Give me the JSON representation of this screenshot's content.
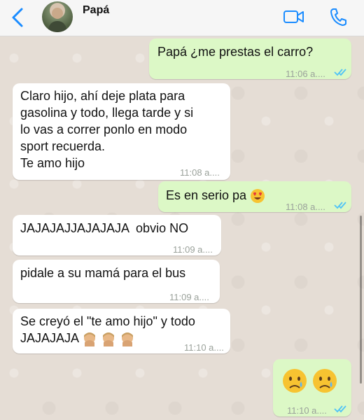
{
  "header": {
    "contact_name": "Papá"
  },
  "messages": [
    {
      "id": "m1",
      "direction": "outgoing",
      "text": "Papá ¿me prestas el carro?",
      "time": "11:06 a....",
      "read": true
    },
    {
      "id": "m2",
      "direction": "incoming",
      "lines": [
        "Claro hijo, ahí deje plata para",
        "gasolina y todo, llega tarde y si",
        "lo vas a correr ponlo en modo",
        "sport recuerda.",
        "Te amo hijo"
      ],
      "time": "11:08 a...."
    },
    {
      "id": "m3",
      "direction": "outgoing",
      "text": "Es en serio pa",
      "emoji": "heart-eyes-emoji",
      "time": "11:08 a....",
      "read": true
    },
    {
      "id": "m4",
      "direction": "incoming",
      "text": "JAJAJAJJAJAJAJA  obvio NO",
      "time": "11:09 a...."
    },
    {
      "id": "m5",
      "direction": "incoming",
      "text": "pidale a su mamá para el bus",
      "time": "11:09 a...."
    },
    {
      "id": "m6",
      "direction": "incoming",
      "lines": [
        "Se creyó el \"te amo hijo\" y todo",
        "JAJAJAJA"
      ],
      "emoji": "facepalm-emoji",
      "emoji_count": 3,
      "time": "11:10 a...."
    },
    {
      "id": "m7",
      "direction": "outgoing",
      "emoji": "crying-face-emoji",
      "emoji_count": 2,
      "time": "11:10 a....",
      "read": true
    }
  ],
  "colors": {
    "accent": "#1a8cff",
    "outgoing_bubble": "#dcf8c6",
    "incoming_bubble": "#ffffff",
    "chat_background": "#e5ddd5",
    "read_ticks": "#4fc3f7"
  },
  "icons": [
    "back-arrow-icon",
    "video-call-icon",
    "phone-call-icon",
    "double-check-icon"
  ]
}
